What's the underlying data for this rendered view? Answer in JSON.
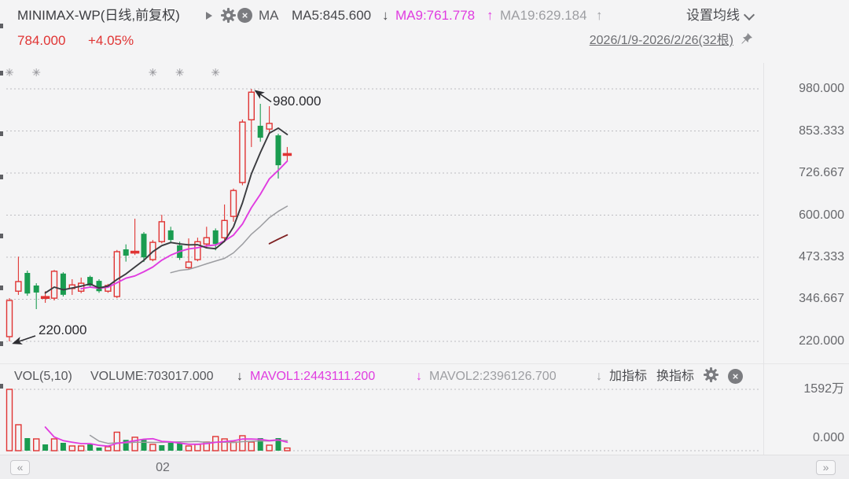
{
  "header": {
    "title": "MINIMAX-WP(日线,前复权)",
    "ma_group_label": "MA",
    "ma5": "MA5:845.600",
    "ma5_dir": "↓",
    "ma9": "MA9:761.778",
    "ma9_dir": "↑",
    "ma19": "MA19:629.184",
    "ma19_dir": "↑",
    "settings": "设置均线",
    "price": "784.000",
    "change": "+4.05%",
    "date_range": "2026/1/9-2026/2/26(32根)"
  },
  "indicator_header": {
    "name": "VOL(5,10)",
    "volume": "VOLUME:703017.000",
    "volume_dir": "↓",
    "mavol1": "MAVOL1:2443111.200",
    "mavol1_dir": "↓",
    "mavol2": "MAVOL2:2396126.700",
    "mavol2_dir": "↓",
    "add": "加指标",
    "switch": "换指标"
  },
  "price_axis_labels": [
    "980.000",
    "853.333",
    "726.667",
    "600.000",
    "473.333",
    "346.667",
    "220.000"
  ],
  "volume_axis_labels": {
    "max": "1592万",
    "zero": "0.000"
  },
  "annotations": {
    "high": "980.000",
    "low": "220.000"
  },
  "scrollbar": {
    "left": "«",
    "right": "»",
    "month": "02"
  },
  "colors": {
    "up": "#e03433",
    "down": "#1a9c50",
    "ma5": "#3a3b3f",
    "ma9": "#e03ce0",
    "ma19": "#9b9ca0",
    "ma30": "#7e2021",
    "mavol1": "#e03ce0",
    "mavol2": "#9b9ca0",
    "grid": "#bdbdc1",
    "background": "#f4f4f5",
    "annotation": "#2c2c31",
    "marker": "#b1b1b5"
  },
  "chart_data": {
    "type": "candlestick",
    "bars": 32,
    "date_range": "2026/1/9-2026/2/26",
    "price_axis": {
      "min": 220,
      "max": 980,
      "ticks": [
        980,
        853.333,
        726.667,
        600,
        473.333,
        346.667,
        220
      ]
    },
    "volume_axis": {
      "max_wan": 1592,
      "min": 0
    },
    "candle_fields": [
      "open",
      "high",
      "low",
      "close",
      "is_up",
      "volume_wan",
      "volume_is_up",
      "has_event_marker"
    ],
    "candles": [
      [
        234,
        350,
        220,
        343,
        1,
        1592,
        1,
        1
      ],
      [
        371,
        475,
        360,
        400,
        1,
        673,
        1,
        0
      ],
      [
        426,
        433,
        357,
        364,
        0,
        327,
        0,
        0
      ],
      [
        388,
        395,
        317,
        367,
        0,
        306,
        1,
        1
      ],
      [
        349,
        371,
        336,
        355,
        1,
        163,
        0,
        0
      ],
      [
        350,
        435,
        343,
        431,
        1,
        306,
        1,
        0
      ],
      [
        424,
        428,
        355,
        360,
        0,
        204,
        0,
        0
      ],
      [
        379,
        407,
        360,
        390,
        1,
        122,
        1,
        0
      ],
      [
        371,
        412,
        365,
        395,
        1,
        122,
        1,
        0
      ],
      [
        414,
        418,
        383,
        388,
        0,
        163,
        0,
        0
      ],
      [
        402,
        407,
        366,
        371,
        0,
        82,
        0,
        0
      ],
      [
        371,
        393,
        366,
        388,
        1,
        102,
        1,
        0
      ],
      [
        355,
        495,
        350,
        490,
        1,
        480,
        1,
        0
      ],
      [
        497,
        512,
        460,
        478,
        0,
        280,
        0,
        0
      ],
      [
        485,
        589,
        480,
        492,
        1,
        350,
        1,
        0
      ],
      [
        544,
        549,
        459,
        473,
        0,
        280,
        0,
        0
      ],
      [
        466,
        525,
        461,
        518,
        1,
        163,
        1,
        1
      ],
      [
        520,
        601,
        515,
        580,
        1,
        143,
        0,
        0
      ],
      [
        554,
        565,
        515,
        525,
        0,
        204,
        0,
        0
      ],
      [
        509,
        520,
        465,
        471,
        0,
        204,
        0,
        1
      ],
      [
        442,
        530,
        438,
        459,
        1,
        122,
        1,
        0
      ],
      [
        466,
        532,
        461,
        520,
        1,
        163,
        1,
        0
      ],
      [
        513,
        565,
        501,
        532,
        1,
        224,
        1,
        0
      ],
      [
        554,
        560,
        494,
        513,
        0,
        367,
        1,
        1
      ],
      [
        532,
        632,
        518,
        584,
        1,
        306,
        1,
        0
      ],
      [
        596,
        680,
        580,
        674,
        1,
        224,
        1,
        0
      ],
      [
        698,
        888,
        690,
        880,
        1,
        388,
        1,
        0
      ],
      [
        887,
        980,
        805,
        970,
        1,
        224,
        1,
        0
      ],
      [
        869,
        935,
        821,
        833,
        0,
        327,
        0,
        0
      ],
      [
        859,
        928,
        845,
        876,
        1,
        143,
        1,
        0
      ],
      [
        840,
        845,
        710,
        750,
        0,
        327,
        0,
        0
      ],
      [
        781,
        805,
        762,
        784,
        1,
        70.3,
        1,
        0
      ]
    ],
    "overlays": [
      {
        "name": "MA5",
        "period": 5,
        "color": "ma5"
      },
      {
        "name": "MA9",
        "period": 9,
        "color": "ma9"
      },
      {
        "name": "MA19",
        "period": 19,
        "color": "ma19"
      },
      {
        "name": "MA30",
        "period": 30,
        "color": "ma30"
      }
    ],
    "volume_overlays": [
      {
        "name": "MAVOL1",
        "period": 5,
        "color": "mavol1"
      },
      {
        "name": "MAVOL2",
        "period": 10,
        "color": "mavol2"
      }
    ]
  }
}
